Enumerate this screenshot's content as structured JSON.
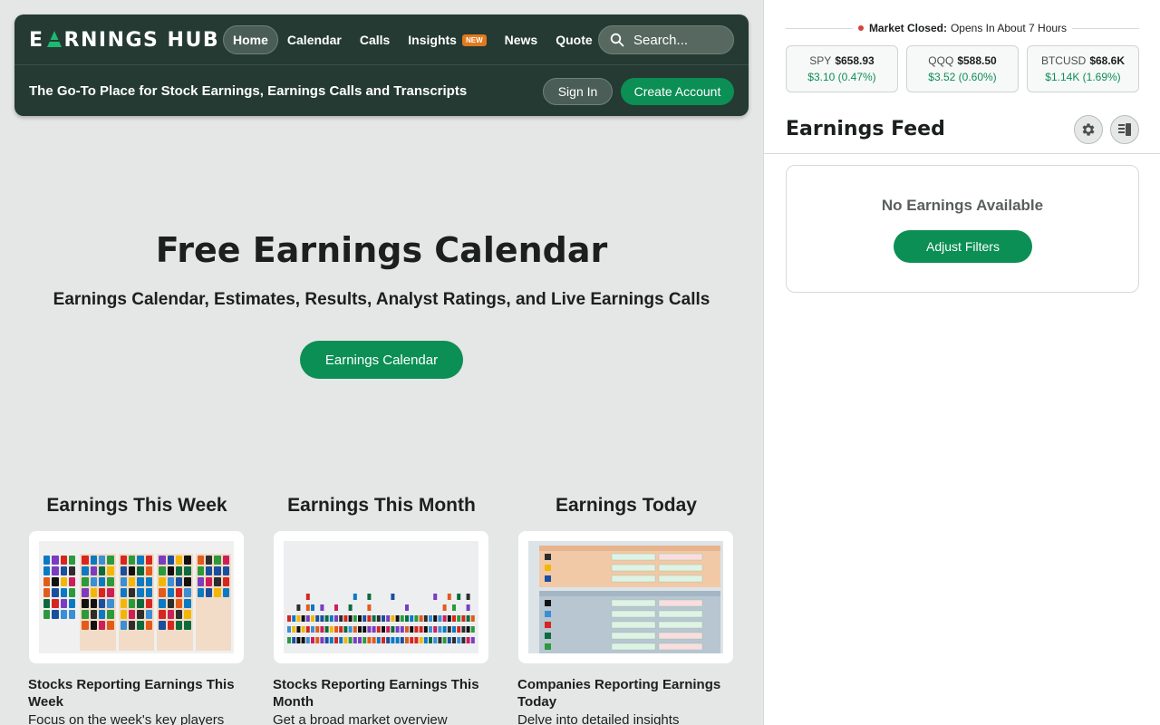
{
  "header": {
    "logo_pre": "E",
    "logo_post": "RNINGS HUB",
    "nav": [
      {
        "label": "Home",
        "active": true
      },
      {
        "label": "Calendar"
      },
      {
        "label": "Calls"
      },
      {
        "label": "Insights",
        "badge": "NEW"
      },
      {
        "label": "News"
      },
      {
        "label": "Quote"
      }
    ],
    "search_placeholder": "Search...",
    "tagline": "The Go-To Place for Stock Earnings, Earnings Calls and Transcripts",
    "sign_in": "Sign In",
    "create_account": "Create Account"
  },
  "hero": {
    "title": "Free Earnings Calendar",
    "subtitle": "Earnings Calendar, Estimates, Results, Analyst Ratings, and Live Earnings Calls",
    "button": "Earnings Calendar"
  },
  "cards": [
    {
      "heading": "Earnings This Week",
      "title": "Stocks Reporting Earnings This Week",
      "desc": "Focus on the week's key players"
    },
    {
      "heading": "Earnings This Month",
      "title": "Stocks Reporting Earnings This Month",
      "desc": "Get a broad market overview"
    },
    {
      "heading": "Earnings Today",
      "title": "Companies Reporting Earnings Today",
      "desc": "Delve into detailed insights"
    }
  ],
  "sidebar": {
    "market_label": "Market Closed:",
    "market_detail": "Opens In About 7 Hours",
    "tickers": [
      {
        "symbol": "SPY",
        "price": "$658.93",
        "change": "$3.10 (0.47%)"
      },
      {
        "symbol": "QQQ",
        "price": "$588.50",
        "change": "$3.52 (0.60%)"
      },
      {
        "symbol": "BTCUSD",
        "price": "$68.6K",
        "change": "$1.14K (1.69%)"
      }
    ],
    "feed_title": "Earnings Feed",
    "empty_text": "No Earnings Available",
    "adjust_filters": "Adjust Filters"
  },
  "colors": {
    "header_bg": "#243a33",
    "accent_green": "#0b8f55",
    "page_bg": "#e4e7e5",
    "status_red": "#d0423a"
  }
}
